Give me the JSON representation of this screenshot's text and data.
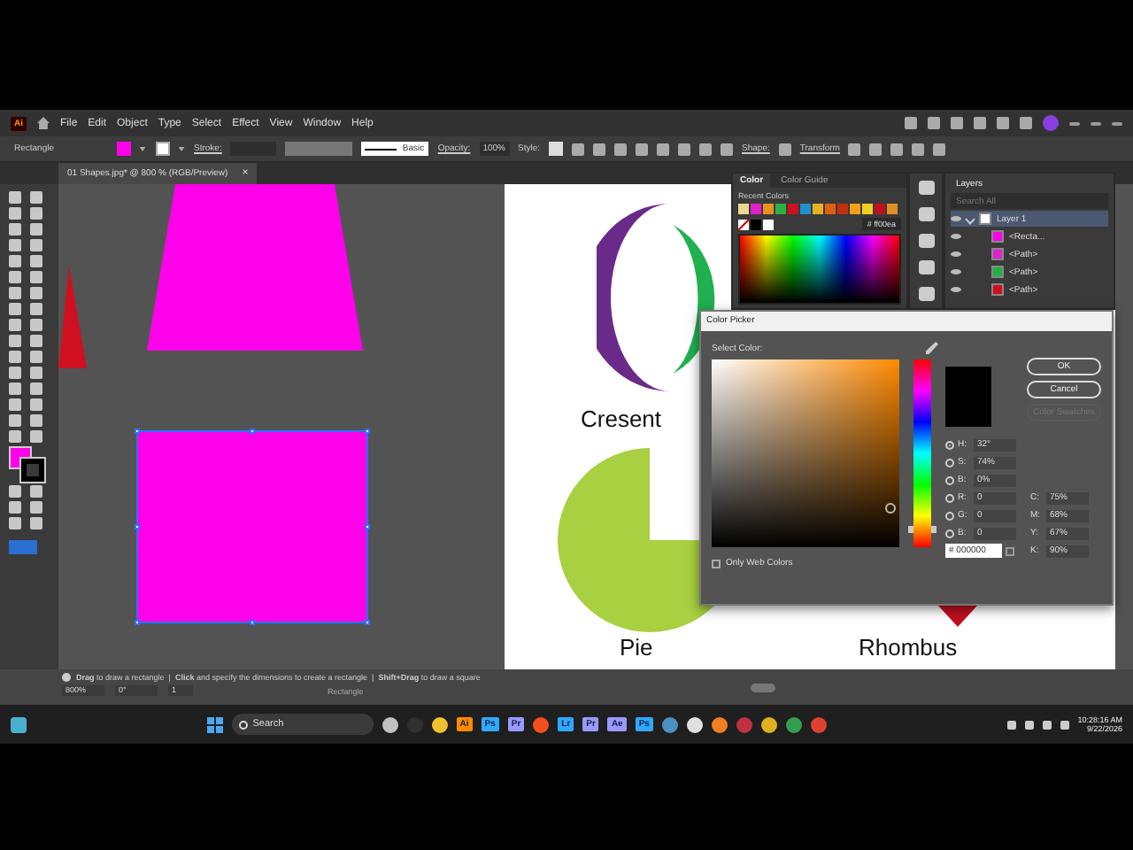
{
  "app": {
    "logo": "Ai"
  },
  "menu": [
    "File",
    "Edit",
    "Object",
    "Type",
    "Select",
    "Effect",
    "View",
    "Window",
    "Help"
  ],
  "control_bar": {
    "tool": "Rectangle",
    "stroke_label": "Stroke:",
    "brush": "Basic",
    "opacity_label": "Opacity:",
    "opacity": "100%",
    "style_label": "Style:",
    "shape_label": "Shape:",
    "transform_label": "Transform"
  },
  "document_tab": {
    "title": "01 Shapes.jpg* @ 800 % (RGB/Preview)",
    "close": "×"
  },
  "canvas": {
    "labels": [
      "Cresent",
      "Pie",
      "Rhombus"
    ]
  },
  "color_panel": {
    "tabs": [
      {
        "label": "Color",
        "selected": true
      },
      {
        "label": "Color Guide",
        "selected": false
      }
    ],
    "recent_label": "Recent Colors",
    "recent_colors": [
      {
        "color": "#e8d890"
      },
      {
        "color": "#e020c8"
      },
      {
        "color": "#e89020"
      },
      {
        "color": "#30b040"
      },
      {
        "color": "#d01020"
      },
      {
        "color": "#2090d0"
      },
      {
        "color": "#e8b020"
      },
      {
        "color": "#e06010"
      },
      {
        "color": "#c03010"
      },
      {
        "color": "#f0a010"
      },
      {
        "color": "#f0d020"
      },
      {
        "color": "#c01020"
      },
      {
        "color": "#e09020"
      }
    ],
    "hex": "# ff00ea"
  },
  "layers_panel": {
    "title": "Layers",
    "search": {
      "placeholder": "Search All"
    },
    "layers": [
      {
        "name": "Layer 1",
        "expanded": true,
        "selected": true,
        "children": [
          {
            "name": "<Recta...",
            "color": "#ff00ea"
          },
          {
            "name": "<Path>",
            "color": "#e020d0"
          },
          {
            "name": "<Path>",
            "color": "#20b040"
          },
          {
            "name": "<Path>",
            "color": "#d01020"
          }
        ]
      }
    ]
  },
  "color_picker": {
    "title": "Color Picker",
    "select_label": "Select Color:",
    "buttons": [
      {
        "label": "OK",
        "disabled": false
      },
      {
        "label": "Cancel",
        "disabled": false
      },
      {
        "label": "Color Swatches",
        "disabled": true
      }
    ],
    "fields": [
      {
        "label": "H:",
        "value": "32°",
        "selected": true
      },
      {
        "label": "S:",
        "value": "74%",
        "selected": false
      },
      {
        "label": "B:",
        "value": "0%",
        "selected": false
      },
      {
        "label": "R:",
        "value": "0",
        "selected": false
      },
      {
        "label": "G:",
        "value": "0",
        "selected": false
      },
      {
        "label": "B:",
        "value": "0",
        "selected": false
      }
    ],
    "cmyk": [
      {
        "label": "C:",
        "value": "75%"
      },
      {
        "label": "M:",
        "value": "68%"
      },
      {
        "label": "Y:",
        "value": "67%"
      },
      {
        "label": "K:",
        "value": "90%"
      }
    ],
    "hue_slider": {
      "level": 0.09
    },
    "hex": {
      "prefix": "#",
      "value": "000000"
    },
    "web_only": {
      "label": "Only Web Colors",
      "checked": false
    }
  },
  "status_bar": {
    "zoom": "800%",
    "rotation": "0°",
    "artboard": "1",
    "tool": "Rectangle",
    "hint": "**Drag** to draw a rectangle  |  **Click** and specify the dimensions to create a rectangle  |  **Shift+Drag** to draw a square"
  },
  "taskbar": {
    "search": {
      "placeholder": "Search"
    },
    "apps": [
      {
        "kind": "icon",
        "color": "#c0c0c0"
      },
      {
        "kind": "icon",
        "color": "#303030"
      },
      {
        "kind": "icon",
        "color": "#f0c030"
      },
      {
        "kind": "tile",
        "label": "Ai",
        "color": "#ff8a00"
      },
      {
        "kind": "tile",
        "label": "Ps",
        "color": "#31a8ff"
      },
      {
        "kind": "tile",
        "label": "Pr",
        "color": "#9999ff"
      },
      {
        "kind": "icon",
        "color": "#f24e1e"
      },
      {
        "kind": "tile",
        "label": "Lr",
        "color": "#31a8ff"
      },
      {
        "kind": "tile",
        "label": "Pr",
        "color": "#9999ff"
      },
      {
        "kind": "tile",
        "label": "Ae",
        "color": "#9999ff"
      },
      {
        "kind": "tile",
        "label": "Ps",
        "color": "#31a8ff"
      },
      {
        "kind": "icon",
        "color": "#4a90c0"
      },
      {
        "kind": "icon",
        "color": "#e0e0e0"
      },
      {
        "kind": "icon",
        "color": "#f08020"
      },
      {
        "kind": "icon",
        "color": "#c03040"
      },
      {
        "kind": "icon",
        "color": "#e0b020"
      },
      {
        "kind": "icon",
        "color": "#30a050"
      },
      {
        "kind": "icon",
        "color": "#e04030"
      }
    ],
    "time": "10:28:16 AM",
    "date": "9/22/2026"
  }
}
